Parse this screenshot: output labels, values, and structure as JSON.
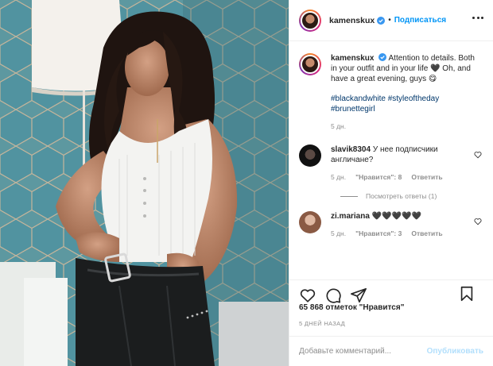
{
  "header": {
    "username": "kamenskux",
    "separator": "•",
    "follow_label": "Подписаться"
  },
  "caption": {
    "username": "kamenskux",
    "text": "Attention to details. Both in your outfit and in your life 🖤 Oh, and have a great evening, guys 😋",
    "hashtags": "#blackandwhite #styleoftheday #brunettegirl",
    "time": "5 дн."
  },
  "comments": [
    {
      "username": "slavik8304",
      "text": "У нее подписчики англичане?",
      "time": "5 дн.",
      "likes": "\"Нравится\": 8",
      "reply_label": "Ответить",
      "view_replies": "Посмотреть ответы (1)"
    },
    {
      "username": "zi.mariana",
      "text": "🖤🖤🖤🖤🖤",
      "time": "5 дн.",
      "likes": "\"Нравится\": 3",
      "reply_label": "Ответить"
    }
  ],
  "likes_text": "65 868 отметок \"Нравится\"",
  "post_date": "5 ДНЕЙ НАЗАД",
  "comment_box": {
    "placeholder": "Добавьте комментарий...",
    "publish_label": "Опубликовать"
  },
  "icons": {
    "like": "heart-outline-icon",
    "comment": "comment-bubble-icon",
    "share": "paper-plane-icon",
    "save": "bookmark-icon",
    "more": "more-dots-icon",
    "verified": "verified-badge-icon"
  },
  "colors": {
    "link_blue": "#0095f6",
    "hashtag": "#00376b",
    "muted": "#8e8e8e",
    "verified": "#3897f0"
  }
}
